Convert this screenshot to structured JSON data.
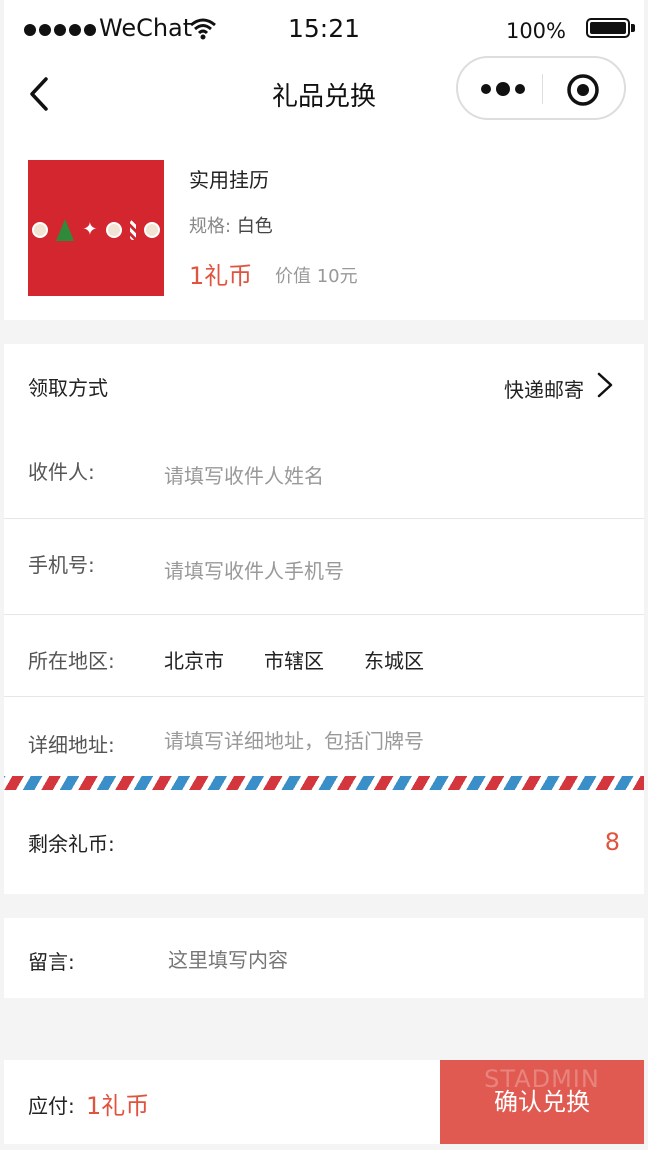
{
  "status_bar": {
    "carrier": "WeChat",
    "time": "15:21",
    "battery": "100%"
  },
  "nav": {
    "title": "礼品兑换",
    "more_icon": "more-dots-icon",
    "close_icon": "target-circle-icon"
  },
  "product": {
    "name": "实用挂历",
    "spec_label": "规格:",
    "spec_value": "白色",
    "price": "1礼币",
    "worth": "价值 10元"
  },
  "form": {
    "pickup": {
      "label": "领取方式",
      "value": "快递邮寄"
    },
    "receiver": {
      "label": "收件人:",
      "placeholder": "请填写收件人姓名"
    },
    "phone": {
      "label": "手机号:",
      "placeholder": "请填写收件人手机号"
    },
    "region": {
      "label": "所在地区:",
      "province": "北京市",
      "city": "市辖区",
      "district": "东城区"
    },
    "address": {
      "label": "详细地址:",
      "placeholder": "请填写详细地址，包括门牌号"
    }
  },
  "coins": {
    "label": "剩余礼币:",
    "value": "8"
  },
  "message": {
    "label": "留言:",
    "placeholder": "这里填写内容"
  },
  "bottom": {
    "pay_label": "应付:",
    "pay_amount": "1礼币",
    "watermark": "STADMIN",
    "confirm_label": "确认兑换"
  },
  "colors": {
    "accent": "#e0533f",
    "confirm_button": "#e05a52",
    "stripe_red": "#d3363c",
    "stripe_blue": "#3a8fc9"
  }
}
